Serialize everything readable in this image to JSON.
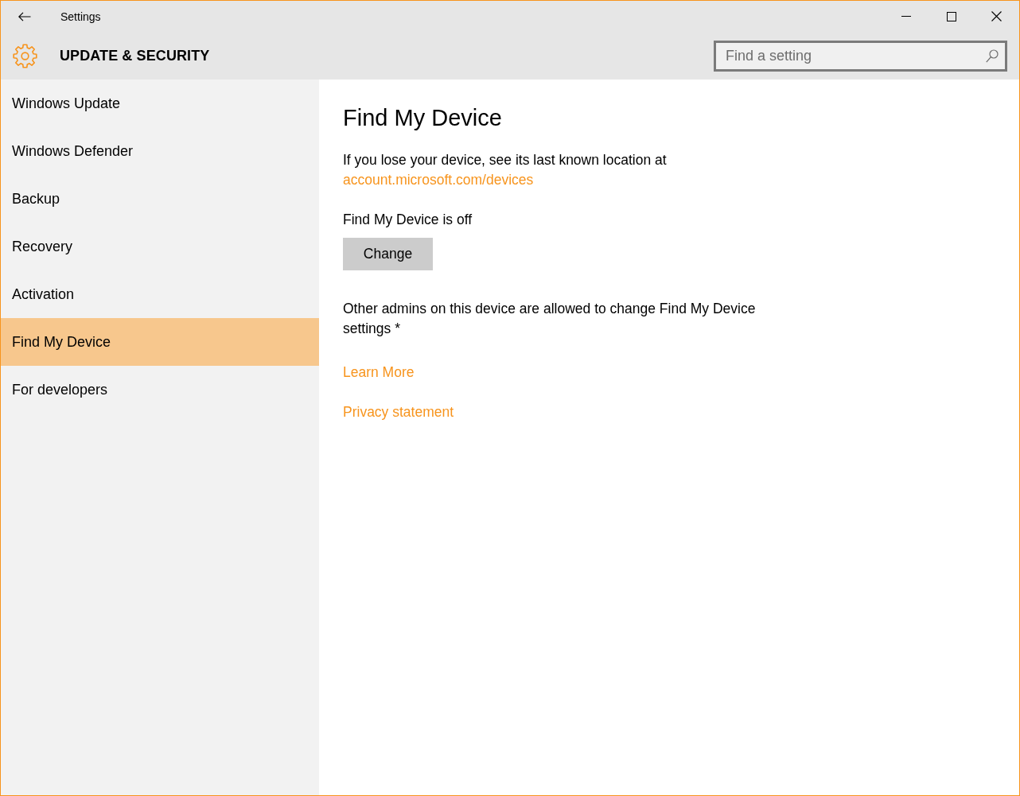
{
  "window": {
    "title": "Settings"
  },
  "header": {
    "title": "UPDATE & SECURITY"
  },
  "search": {
    "placeholder": "Find a setting"
  },
  "sidebar": {
    "items": [
      {
        "label": "Windows Update",
        "selected": false
      },
      {
        "label": "Windows Defender",
        "selected": false
      },
      {
        "label": "Backup",
        "selected": false
      },
      {
        "label": "Recovery",
        "selected": false
      },
      {
        "label": "Activation",
        "selected": false
      },
      {
        "label": "Find My Device",
        "selected": true
      },
      {
        "label": "For developers",
        "selected": false
      }
    ]
  },
  "content": {
    "title": "Find My Device",
    "location_text": "If you lose your device, see its last known location at",
    "location_link": "account.microsoft.com/devices",
    "status": "Find My Device is off",
    "change_button": "Change",
    "admins_note": "Other admins on this device are allowed to change Find My Device settings *",
    "links": [
      "Learn More",
      "Privacy statement"
    ]
  }
}
